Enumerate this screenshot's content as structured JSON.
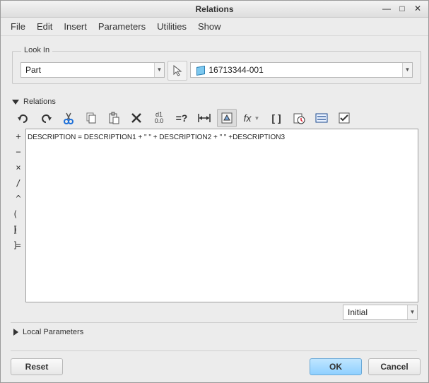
{
  "window": {
    "title": "Relations",
    "controls": {
      "minimize": "—",
      "maximize": "□",
      "close": "✕"
    }
  },
  "menubar": {
    "items": [
      "File",
      "Edit",
      "Insert",
      "Parameters",
      "Utilities",
      "Show"
    ]
  },
  "look_in": {
    "legend": "Look In",
    "type_value": "Part",
    "model_value": "16713344-001"
  },
  "relations": {
    "header": "Relations",
    "toolbar_icons": [
      "undo-icon",
      "redo-icon",
      "cut-icon",
      "copy-icon",
      "paste-icon",
      "delete-icon",
      "switch-dimensions-icon",
      "evaluate-icon",
      "insert-dimension-icon",
      "sort-icon",
      "function-icon",
      "brackets-icon",
      "verify-icon",
      "units-icon",
      "check-icon"
    ],
    "toolbar_text": {
      "switch_dims_top": "d1",
      "switch_dims_bottom": "0.0",
      "evaluate": "=?",
      "function": "fx",
      "brackets": "[ ]"
    },
    "operators": [
      "+",
      "−",
      "×",
      "/",
      "^",
      "( )",
      "[ ]",
      "="
    ],
    "editor_text": "DESCRIPTION = DESCRIPTION1 + \" \" + DESCRIPTION2 + \" \" +DESCRIPTION3",
    "initial_value": "Initial"
  },
  "local_parameters": {
    "label": "Local Parameters"
  },
  "footer": {
    "reset": "Reset",
    "ok": "OK",
    "cancel": "Cancel"
  }
}
